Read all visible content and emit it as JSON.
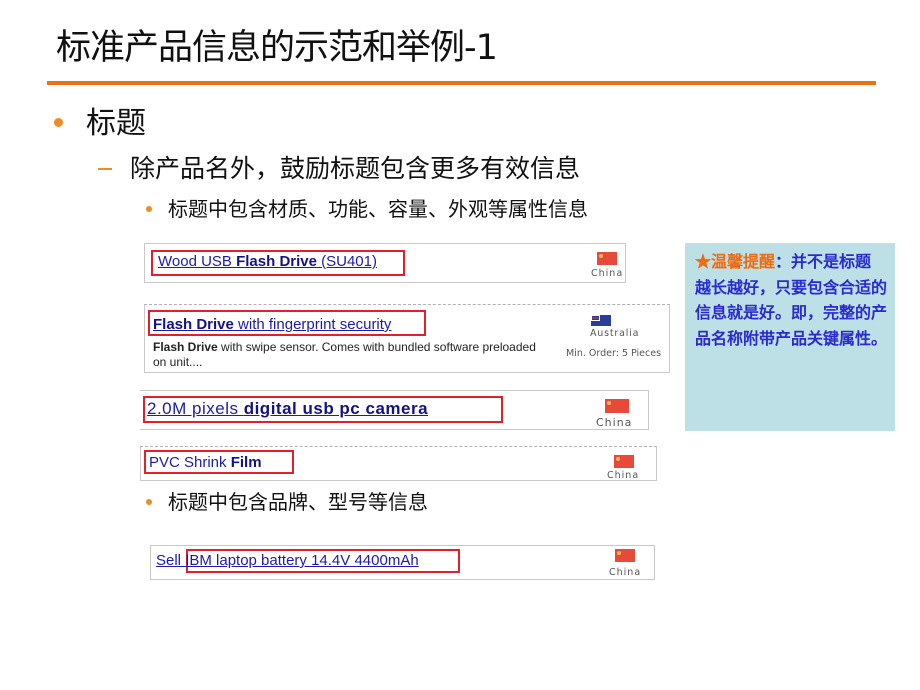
{
  "slide": {
    "title": "标准产品信息的示范和举例-1",
    "accent_color": "#f07010",
    "bullets": {
      "level1": "标题",
      "level2": "除产品名外，鼓励标题包含更多有效信息",
      "level3_a": "标题中包含材质、功能、容量、外观等属性信息",
      "level3_b": "标题中包含品牌、型号等信息"
    }
  },
  "examples": [
    {
      "title_normal_1": "Wood USB ",
      "title_bold": "Flash Drive",
      "title_normal_2": " (SU401)",
      "country": "China",
      "flag": "china-flag"
    },
    {
      "title_bold": "Flash Drive",
      "title_normal": " with fingerprint security",
      "desc_bold": "Flash Drive",
      "desc_rest": " with swipe sensor. Comes with bundled software preloaded on unit....",
      "country": "Australia",
      "flag": "australia-flag",
      "min_order": "Min. Order: 5 Pieces"
    },
    {
      "title_normal": "2.0M pixels ",
      "title_bold": "digital usb pc camera",
      "country": "China",
      "flag": "china-flag"
    },
    {
      "title_normal": "PVC Shrink ",
      "title_bold": "Film",
      "country": "China",
      "flag": "china-flag"
    },
    {
      "title_prefix": "Sell ",
      "title_highlight": "IBM laptop battery 14.4V 4400mAh",
      "country": "China",
      "flag": "china-flag"
    }
  ],
  "tip": {
    "star": "★",
    "heading": "温馨提醒",
    "body": "：并不是标题越长越好，只要包含合适的信息就是好。即，完整的产品名称附带产品关键属性。",
    "background": "#bde0e6",
    "heading_color": "#f06a10",
    "text_color": "#2a2ad0"
  }
}
